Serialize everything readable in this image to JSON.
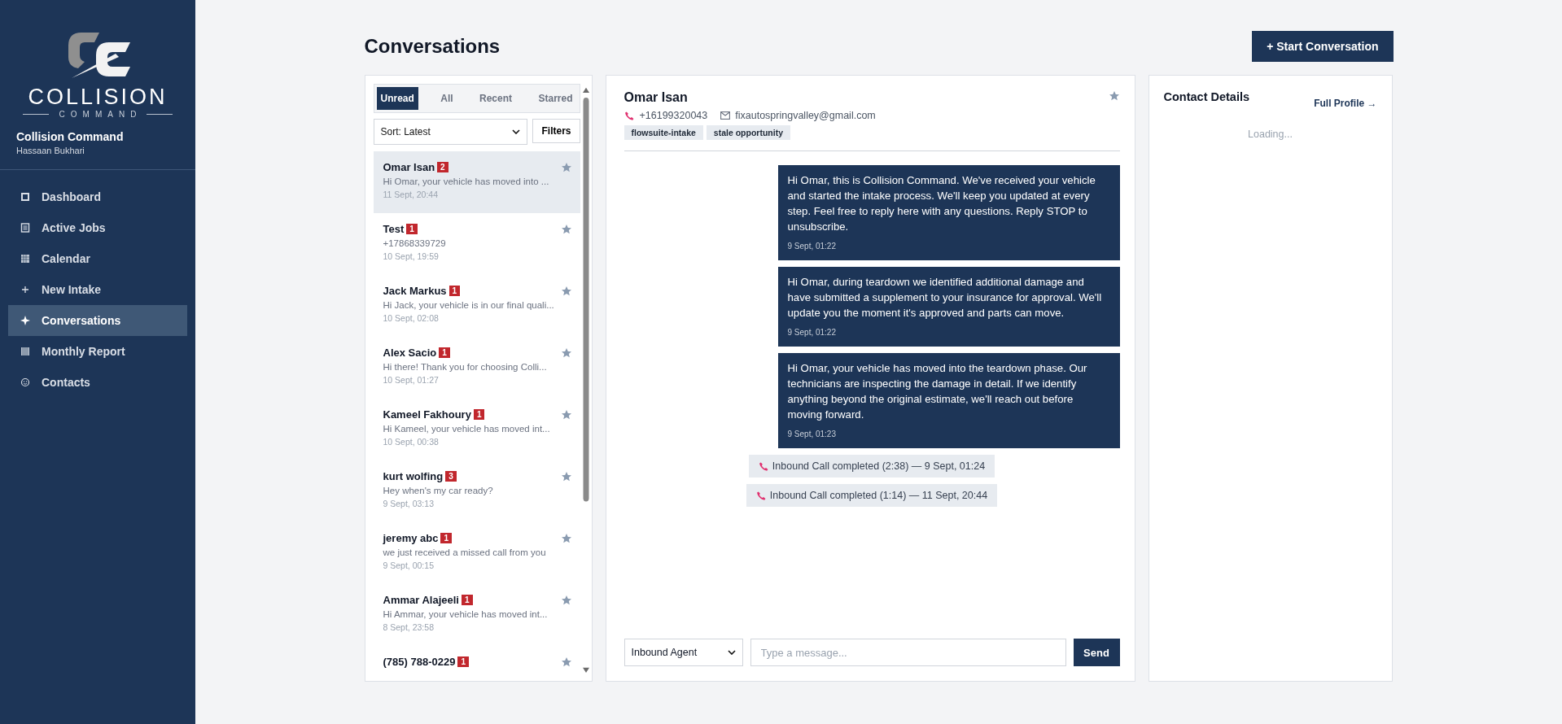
{
  "sidebar": {
    "logo": {
      "wordmark": "COLLISION",
      "tagline": "COMMAND"
    },
    "org": "Collision Command",
    "user": "Hassaan Bukhari",
    "items": [
      {
        "label": "Dashboard",
        "kind": "square",
        "selected": false
      },
      {
        "label": "Active Jobs",
        "kind": "list",
        "selected": false
      },
      {
        "label": "Calendar",
        "kind": "grid",
        "selected": false
      },
      {
        "label": "New Intake",
        "kind": "plus",
        "selected": false
      },
      {
        "label": "Conversations",
        "kind": "sparkle",
        "selected": true
      },
      {
        "label": "Monthly Report",
        "kind": "bars",
        "selected": false
      },
      {
        "label": "Contacts",
        "kind": "face",
        "selected": false
      }
    ]
  },
  "page": {
    "title": "Conversations",
    "action": "+ Start Conversation"
  },
  "list": {
    "tabs": [
      {
        "label": "Unread",
        "selected": true
      },
      {
        "label": "All",
        "selected": false
      },
      {
        "label": "Recent",
        "selected": false
      },
      {
        "label": "Starred",
        "selected": false
      }
    ],
    "sort": "Sort: Latest",
    "filters": "Filters",
    "conversations": [
      {
        "name": "Omar Isan",
        "unread": "2",
        "preview": "Hi Omar, your vehicle has moved into ...",
        "time": "11 Sept, 20:44",
        "selected": true,
        "starred": false
      },
      {
        "name": "Test",
        "unread": "1",
        "preview": "+17868339729",
        "time": "10 Sept, 19:59",
        "selected": false,
        "starred": false
      },
      {
        "name": "Jack Markus",
        "unread": "1",
        "preview": "Hi Jack, your vehicle is in our final quali...",
        "time": "10 Sept, 02:08",
        "selected": false,
        "starred": false
      },
      {
        "name": "Alex Sacio",
        "unread": "1",
        "preview": "Hi there! Thank you for choosing Colli...",
        "time": "10 Sept, 01:27",
        "selected": false,
        "starred": false
      },
      {
        "name": "Kameel Fakhoury",
        "unread": "1",
        "preview": "Hi Kameel, your vehicle has moved int...",
        "time": "10 Sept, 00:38",
        "selected": false,
        "starred": false
      },
      {
        "name": "kurt wolfing",
        "unread": "3",
        "preview": "Hey when's my car ready?",
        "time": "9 Sept, 03:13",
        "selected": false,
        "starred": false
      },
      {
        "name": "jeremy abc",
        "unread": "1",
        "preview": "we just received a missed call from you",
        "time": "9 Sept, 00:15",
        "selected": false,
        "starred": false
      },
      {
        "name": "Ammar Alajeeli",
        "unread": "1",
        "preview": "Hi Ammar, your vehicle has moved int...",
        "time": "8 Sept, 23:58",
        "selected": false,
        "starred": false
      },
      {
        "name": "(785) 788-0229",
        "unread": "1",
        "selected": false,
        "starred": false
      }
    ]
  },
  "chat": {
    "name": "Omar Isan",
    "starred": false,
    "phone": "+16199320043",
    "email": "fixautospringvalley@gmail.com",
    "tags": [
      "flowsuite-intake",
      "stale opportunity"
    ],
    "messages": [
      {
        "kind": "sms",
        "text": "Hi Omar, this is Collision Command. We've received your vehicle and started the intake process. We'll keep you updated at every step. Feel free to reply here with any questions. Reply STOP to unsubscribe.",
        "time": "9 Sept, 01:22"
      },
      {
        "kind": "sms",
        "text": "Hi Omar, during teardown we identified additional damage and have submitted a supplement to your insurance for approval. We'll update you the moment it's approved and parts can move.",
        "time": "9 Sept, 01:22"
      },
      {
        "kind": "sms",
        "text": "Hi Omar, your vehicle has moved into the teardown phase. Our technicians are inspecting the damage in detail. If we identify anything beyond the original estimate, we'll reach out before moving forward.",
        "time": "9 Sept, 01:23"
      },
      {
        "kind": "call",
        "text": "Inbound Call completed (2:38) — 9 Sept, 01:24"
      },
      {
        "kind": "call",
        "text": "Inbound Call completed (1:14) — 11 Sept, 20:44"
      }
    ],
    "agent": "Inbound Agent",
    "placeholder": "Type a message...",
    "send": "Send"
  },
  "contact": {
    "title": "Contact Details",
    "link": "Full Profile →",
    "status": "Loading..."
  }
}
